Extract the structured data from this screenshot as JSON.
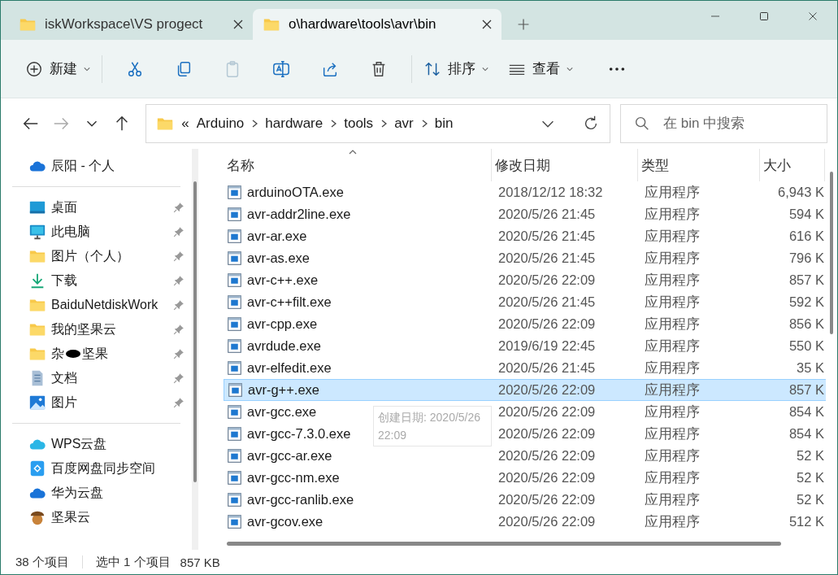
{
  "tabs": [
    {
      "title": "iskWorkspace\\VS progect",
      "selected": false
    },
    {
      "title": "o\\hardware\\tools\\avr\\bin",
      "selected": true
    }
  ],
  "toolbar": {
    "new_label": "新建",
    "actions": [
      {
        "kind": "cut",
        "disabled": false
      },
      {
        "kind": "copy",
        "disabled": false
      },
      {
        "kind": "paste",
        "disabled": true
      },
      {
        "kind": "rename",
        "disabled": false
      },
      {
        "kind": "share",
        "disabled": false
      },
      {
        "kind": "delete",
        "disabled": false
      }
    ],
    "sort_label": "排序",
    "view_label": "查看"
  },
  "address": {
    "overflow": "«",
    "crumbs": [
      "Arduino",
      "hardware",
      "tools",
      "avr",
      "bin"
    ]
  },
  "search": {
    "placeholder": "在 bin 中搜索"
  },
  "sidebar": {
    "groups": [
      {
        "items": [
          {
            "label": "辰阳 - 个人",
            "kind": "cloud",
            "pinned": false
          }
        ]
      },
      {
        "items": [
          {
            "label": "桌面",
            "kind": "desktop",
            "pinned": true
          },
          {
            "label": "此电脑",
            "kind": "pc",
            "pinned": true
          },
          {
            "label": "图片（个人）",
            "kind": "folder",
            "pinned": true
          },
          {
            "label": "下载",
            "kind": "download",
            "pinned": true
          },
          {
            "label": "BaiduNetdiskWork",
            "kind": "folder",
            "pinned": true
          },
          {
            "label": "我的坚果云",
            "kind": "folder",
            "pinned": true
          },
          {
            "label": "杂",
            "kind": "folder-blot",
            "pinned": true,
            "suffix": "坚果"
          },
          {
            "label": "文档",
            "kind": "document",
            "pinned": true
          },
          {
            "label": "图片",
            "kind": "picture",
            "pinned": true
          }
        ]
      },
      {
        "items": [
          {
            "label": "WPS云盘",
            "kind": "cloud-aqua",
            "pinned": false
          },
          {
            "label": "百度网盘同步空间",
            "kind": "baidu",
            "pinned": false
          },
          {
            "label": "华为云盘",
            "kind": "cloud",
            "pinned": false
          },
          {
            "label": "坚果云",
            "kind": "acorn",
            "pinned": false
          }
        ]
      }
    ]
  },
  "table": {
    "columns": [
      "名称",
      "修改日期",
      "类型",
      "大小"
    ],
    "rows": [
      {
        "name": "arduinoOTA.exe",
        "date": "2018/12/12 18:32",
        "type": "应用程序",
        "size": "6,943 K",
        "selected": false
      },
      {
        "name": "avr-addr2line.exe",
        "date": "2020/5/26 21:45",
        "type": "应用程序",
        "size": "594 K",
        "selected": false
      },
      {
        "name": "avr-ar.exe",
        "date": "2020/5/26 21:45",
        "type": "应用程序",
        "size": "616 K",
        "selected": false
      },
      {
        "name": "avr-as.exe",
        "date": "2020/5/26 21:45",
        "type": "应用程序",
        "size": "796 K",
        "selected": false
      },
      {
        "name": "avr-c++.exe",
        "date": "2020/5/26 22:09",
        "type": "应用程序",
        "size": "857 K",
        "selected": false
      },
      {
        "name": "avr-c++filt.exe",
        "date": "2020/5/26 21:45",
        "type": "应用程序",
        "size": "592 K",
        "selected": false
      },
      {
        "name": "avr-cpp.exe",
        "date": "2020/5/26 22:09",
        "type": "应用程序",
        "size": "856 K",
        "selected": false
      },
      {
        "name": "avrdude.exe",
        "date": "2019/6/19 22:45",
        "type": "应用程序",
        "size": "550 K",
        "selected": false
      },
      {
        "name": "avr-elfedit.exe",
        "date": "2020/5/26 21:45",
        "type": "应用程序",
        "size": "35 K",
        "selected": false
      },
      {
        "name": "avr-g++.exe",
        "date": "2020/5/26 22:09",
        "type": "应用程序",
        "size": "857 K",
        "selected": true
      },
      {
        "name": "avr-gcc.exe",
        "date": "2020/5/26 22:09",
        "type": "应用程序",
        "size": "854 K",
        "selected": false
      },
      {
        "name": "avr-gcc-7.3.0.exe",
        "date": "2020/5/26 22:09",
        "type": "应用程序",
        "size": "854 K",
        "selected": false
      },
      {
        "name": "avr-gcc-ar.exe",
        "date": "2020/5/26 22:09",
        "type": "应用程序",
        "size": "52 K",
        "selected": false
      },
      {
        "name": "avr-gcc-nm.exe",
        "date": "2020/5/26 22:09",
        "type": "应用程序",
        "size": "52 K",
        "selected": false
      },
      {
        "name": "avr-gcc-ranlib.exe",
        "date": "2020/5/26 22:09",
        "type": "应用程序",
        "size": "52 K",
        "selected": false
      },
      {
        "name": "avr-gcov.exe",
        "date": "2020/5/26 22:09",
        "type": "应用程序",
        "size": "512 K",
        "selected": false
      }
    ]
  },
  "tooltip": "创建日期: 2020/5/26 22:09",
  "status_bar": {
    "count": "38 个项目",
    "selection": "选中 1 个项目",
    "size": "857 KB"
  }
}
